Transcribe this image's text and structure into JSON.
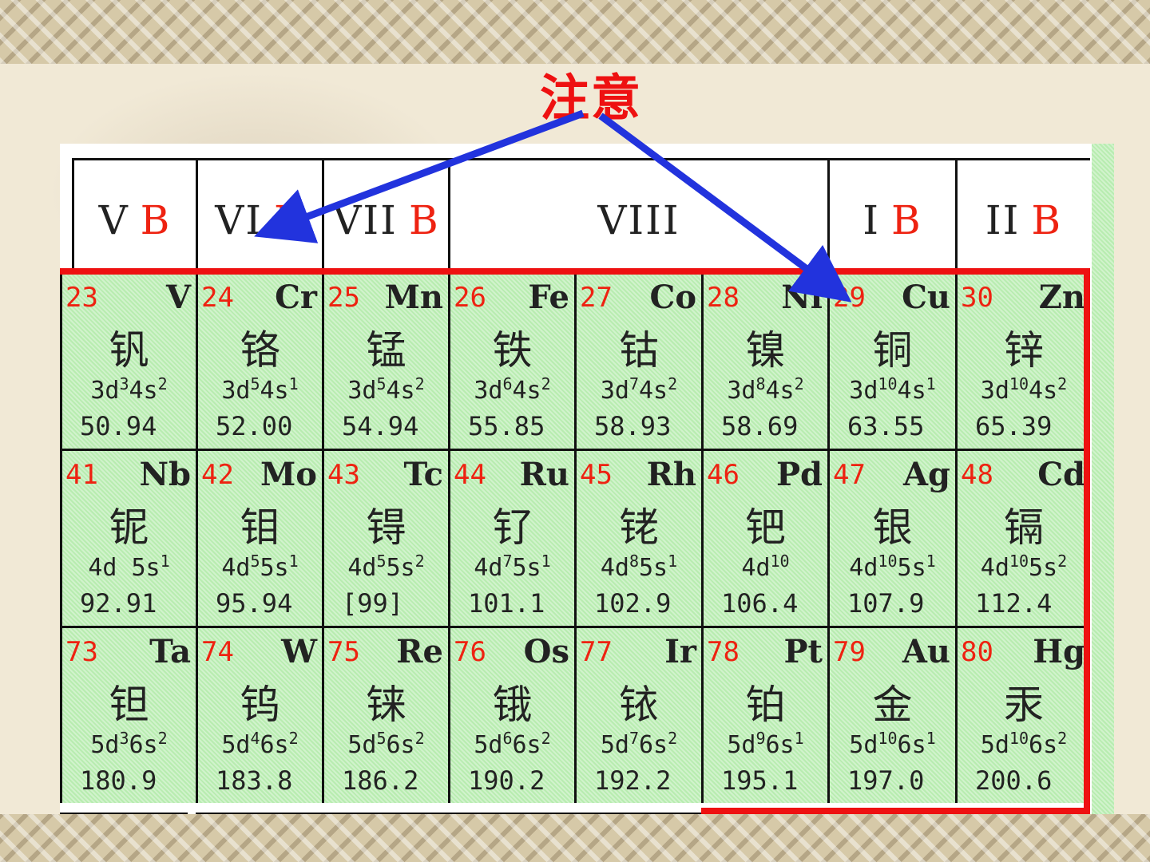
{
  "slide": {
    "title": "注意"
  },
  "header": [
    {
      "roman": "V",
      "b": "B"
    },
    {
      "roman": "VI",
      "b": "B"
    },
    {
      "roman": "VII",
      "b": "B"
    },
    {
      "roman": "VIII",
      "b": ""
    },
    {
      "roman": "I",
      "b": "B"
    },
    {
      "roman": "II",
      "b": "B"
    }
  ],
  "rows": [
    [
      {
        "num": "23",
        "sym": "V",
        "name": "钒",
        "cfg_a": "3d",
        "cfg_a_sup": "3",
        "cfg_b": "4s",
        "cfg_b_sup": "2",
        "mass": "50.94"
      },
      {
        "num": "24",
        "sym": "Cr",
        "name": "铬",
        "cfg_a": "3d",
        "cfg_a_sup": "5",
        "cfg_b": "4s",
        "cfg_b_sup": "1",
        "mass": "52.00"
      },
      {
        "num": "25",
        "sym": "Mn",
        "name": "锰",
        "cfg_a": "3d",
        "cfg_a_sup": "5",
        "cfg_b": "4s",
        "cfg_b_sup": "2",
        "mass": "54.94"
      },
      {
        "num": "26",
        "sym": "Fe",
        "name": "铁",
        "cfg_a": "3d",
        "cfg_a_sup": "6",
        "cfg_b": "4s",
        "cfg_b_sup": "2",
        "mass": "55.85"
      },
      {
        "num": "27",
        "sym": "Co",
        "name": "钴",
        "cfg_a": "3d",
        "cfg_a_sup": "7",
        "cfg_b": "4s",
        "cfg_b_sup": "2",
        "mass": "58.93"
      },
      {
        "num": "28",
        "sym": "Ni",
        "name": "镍",
        "cfg_a": "3d",
        "cfg_a_sup": "8",
        "cfg_b": "4s",
        "cfg_b_sup": "2",
        "mass": "58.69"
      },
      {
        "num": "29",
        "sym": "Cu",
        "name": "铜",
        "cfg_a": "3d",
        "cfg_a_sup": "10",
        "cfg_b": "4s",
        "cfg_b_sup": "1",
        "mass": "63.55"
      },
      {
        "num": "30",
        "sym": "Zn",
        "name": "锌",
        "cfg_a": "3d",
        "cfg_a_sup": "10",
        "cfg_b": "4s",
        "cfg_b_sup": "2",
        "mass": "65.39"
      }
    ],
    [
      {
        "num": "41",
        "sym": "Nb",
        "name": "铌",
        "cfg_a": "4d",
        "cfg_a_sup": "",
        "cfg_b": " 5s",
        "cfg_b_sup": "1",
        "mass": "92.91"
      },
      {
        "num": "42",
        "sym": "Mo",
        "name": "钼",
        "cfg_a": "4d",
        "cfg_a_sup": "5",
        "cfg_b": "5s",
        "cfg_b_sup": "1",
        "mass": "95.94"
      },
      {
        "num": "43",
        "sym": "Tc",
        "name": "锝",
        "cfg_a": "4d",
        "cfg_a_sup": "5",
        "cfg_b": "5s",
        "cfg_b_sup": "2",
        "mass": "[99]"
      },
      {
        "num": "44",
        "sym": "Ru",
        "name": "钌",
        "cfg_a": "4d",
        "cfg_a_sup": "7",
        "cfg_b": "5s",
        "cfg_b_sup": "1",
        "mass": "101.1"
      },
      {
        "num": "45",
        "sym": "Rh",
        "name": "铑",
        "cfg_a": "4d",
        "cfg_a_sup": "8",
        "cfg_b": "5s",
        "cfg_b_sup": "1",
        "mass": "102.9"
      },
      {
        "num": "46",
        "sym": "Pd",
        "name": "钯",
        "cfg_a": "4d",
        "cfg_a_sup": "10",
        "cfg_b": "",
        "cfg_b_sup": "",
        "mass": "106.4"
      },
      {
        "num": "47",
        "sym": "Ag",
        "name": "银",
        "cfg_a": "4d",
        "cfg_a_sup": "10",
        "cfg_b": "5s",
        "cfg_b_sup": "1",
        "mass": "107.9"
      },
      {
        "num": "48",
        "sym": "Cd",
        "name": "镉",
        "cfg_a": "4d",
        "cfg_a_sup": "10",
        "cfg_b": "5s",
        "cfg_b_sup": "2",
        "mass": "112.4"
      }
    ],
    [
      {
        "num": "73",
        "sym": "Ta",
        "name": "钽",
        "cfg_a": "5d",
        "cfg_a_sup": "3",
        "cfg_b": "6s",
        "cfg_b_sup": "2",
        "mass": "180.9"
      },
      {
        "num": "74",
        "sym": "W",
        "name": "钨",
        "cfg_a": "5d",
        "cfg_a_sup": "4",
        "cfg_b": "6s",
        "cfg_b_sup": "2",
        "mass": "183.8"
      },
      {
        "num": "75",
        "sym": "Re",
        "name": "铼",
        "cfg_a": "5d",
        "cfg_a_sup": "5",
        "cfg_b": "6s",
        "cfg_b_sup": "2",
        "mass": "186.2"
      },
      {
        "num": "76",
        "sym": "Os",
        "name": "锇",
        "cfg_a": "5d",
        "cfg_a_sup": "6",
        "cfg_b": "6s",
        "cfg_b_sup": "2",
        "mass": "190.2"
      },
      {
        "num": "77",
        "sym": "Ir",
        "name": "铱",
        "cfg_a": "5d",
        "cfg_a_sup": "7",
        "cfg_b": "6s",
        "cfg_b_sup": "2",
        "mass": "192.2"
      },
      {
        "num": "78",
        "sym": "Pt",
        "name": "铂",
        "cfg_a": "5d",
        "cfg_a_sup": "9",
        "cfg_b": "6s",
        "cfg_b_sup": "1",
        "mass": "195.1"
      },
      {
        "num": "79",
        "sym": "Au",
        "name": "金",
        "cfg_a": "5d",
        "cfg_a_sup": "10",
        "cfg_b": "6s",
        "cfg_b_sup": "1",
        "mass": "197.0"
      },
      {
        "num": "80",
        "sym": "Hg",
        "name": "汞",
        "cfg_a": "5d",
        "cfg_a_sup": "10",
        "cfg_b": "6s",
        "cfg_b_sup": "2",
        "mass": "200.6"
      }
    ]
  ],
  "colors": {
    "accent_red": "#ee1111",
    "arrow_blue": "#2233dd",
    "cell_green": "#b8ecb0"
  }
}
